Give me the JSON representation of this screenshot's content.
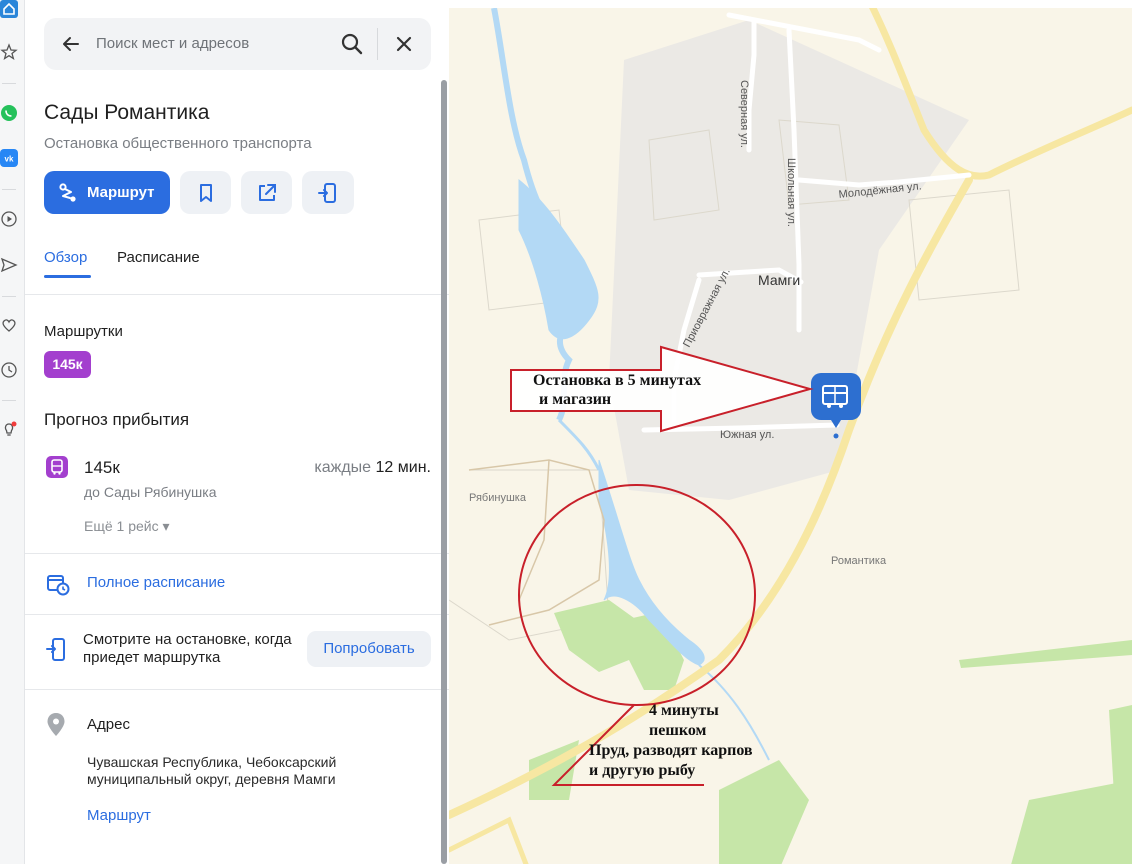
{
  "search": {
    "placeholder": "Поиск мест и адресов"
  },
  "place": {
    "title": "Сады Романтика",
    "subtitle": "Остановка общественного транспорта",
    "route_button": "Маршрут"
  },
  "tabs": [
    {
      "label": "Обзор",
      "active": true
    },
    {
      "label": "Расписание",
      "active": false
    }
  ],
  "minibuses": {
    "heading": "Маршрутки",
    "routes": [
      "145к"
    ],
    "chip_color": "#a33fce"
  },
  "forecast": {
    "heading": "Прогноз прибытия",
    "route": "145к",
    "destination": "до Сады Рябинушка",
    "frequency_prefix": "каждые",
    "frequency_value": "12 мин.",
    "more_trips": "Ещё 1 рейс ▾"
  },
  "full_schedule": {
    "label": "Полное расписание"
  },
  "watch": {
    "text": "Смотрите на остановке, когда приедет маршрутка",
    "button": "Попробовать"
  },
  "address": {
    "heading": "Адрес",
    "text": "Чувашская Республика, Чебоксарский муниципальный округ, деревня Мамги",
    "route_link": "Маршрут"
  },
  "map": {
    "labels": {
      "village": "Мамги",
      "ryabinushka": "Рябинушка",
      "romantika": "Романтика",
      "street_severnaya": "Северная ул.",
      "street_shkolnaya": "Школьная ул.",
      "street_molodezhnaya": "Молодёжная ул.",
      "street_prioverazhnaya": "Приовражная ул.",
      "street_yuzhnaya": "Южная ул."
    },
    "annotations": {
      "stop_note_line1": "Остановка в 5 минутах",
      "stop_note_line2": "и магазин",
      "walk_note_line1": "4 минуты",
      "walk_note_line2": "пешком",
      "pond_note_line1": "Пруд, разводят карпов",
      "pond_note_line2": "и другую рыбу"
    },
    "annotation_color": "#c8202a",
    "stop_marker_color": "#2d6fd0",
    "water_color": "#b3d9f5",
    "road_color": "#f7e7a2"
  }
}
